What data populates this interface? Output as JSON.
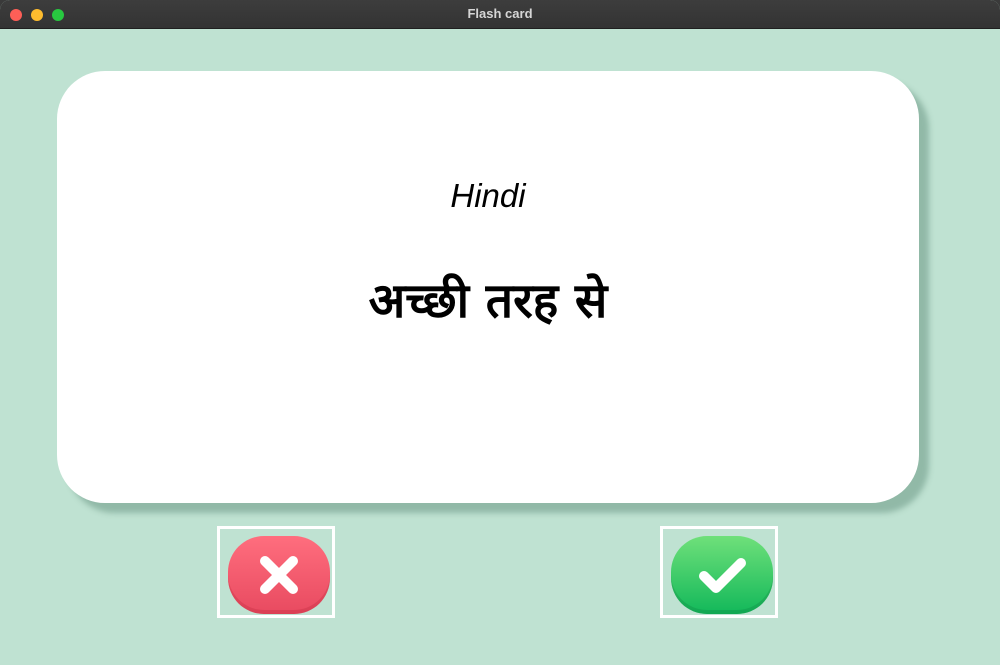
{
  "window": {
    "title": "Flash card"
  },
  "card": {
    "language": "Hindi",
    "word": "अच्छी तरह से"
  },
  "buttons": {
    "wrong": {
      "icon": "x-mark-icon",
      "color": "#ee5568"
    },
    "right": {
      "icon": "check-mark-icon",
      "color": "#2ecb63"
    }
  },
  "colors": {
    "background": "#bfe2d2",
    "card": "#ffffff"
  }
}
